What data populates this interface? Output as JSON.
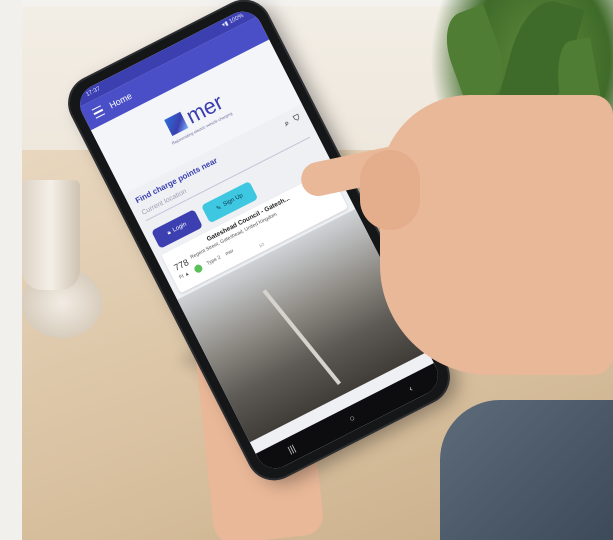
{
  "phone": {
    "status_time": "17:37",
    "status_right": "▾▮ 100%",
    "app_bar_title": "Home",
    "logo_text": "mer",
    "tagline": "Rejuvenating electric vehicle charging",
    "search_title": "Find charge points near",
    "search_placeholder": "Current location",
    "login_label": "Login",
    "signup_label": "Sign Up",
    "card": {
      "title": "Gateshead Council - Gatesh...",
      "number": "778",
      "address": "Regent Street, Gateshead, United Kingdom",
      "connector_label": "Type 2",
      "connector_sub": "mer",
      "page_indicator": "1/2"
    },
    "nav_icons": [
      "recent-apps-icon",
      "home-icon",
      "back-icon"
    ]
  },
  "colors": {
    "app_primary": "#4a4fc7",
    "app_accent": "#3ec7e0",
    "connector_green": "#5bbf5a"
  }
}
